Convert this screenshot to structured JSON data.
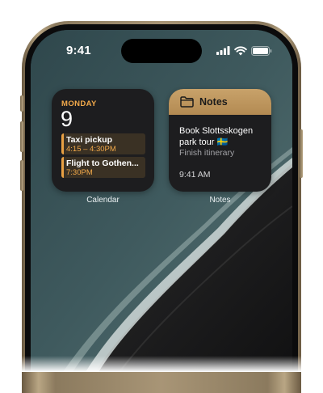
{
  "status_bar": {
    "time": "9:41",
    "icons": [
      "cellular-signal-icon",
      "wifi-icon",
      "battery-icon"
    ]
  },
  "calendar_widget": {
    "day": "MONDAY",
    "date": "9",
    "events": [
      {
        "title": "Taxi pickup",
        "time": "4:15 – 4:30PM"
      },
      {
        "title": "Flight to Gothen...",
        "time": "7:30PM"
      }
    ],
    "label": "Calendar",
    "accent_color": "#f2a94a"
  },
  "notes_widget": {
    "header": "Notes",
    "header_icon": "folder-icon",
    "note_title": "Book Slottsskogen park tour 🇸🇪",
    "note_subtitle": "Finish itinerary",
    "note_time": "9:41 AM",
    "label": "Notes",
    "header_color": "#c8a26a"
  }
}
